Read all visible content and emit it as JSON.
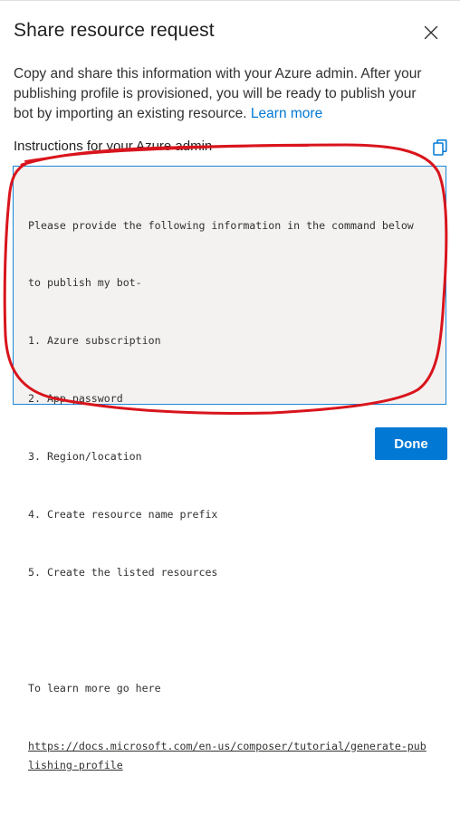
{
  "dialog": {
    "title": "Share resource request",
    "close_icon": "close-icon",
    "description": "Copy and share this information with your Azure admin. After your publishing profile is provisioned, you will be ready to publish your bot by importing an existing resource.",
    "learn_more_link": "Learn more",
    "section_label": "Instructions for your Azure admin",
    "copy_icon": "copy-icon",
    "instructions": {
      "intro_line1": "Please provide the following information in the command below",
      "intro_line2": "to publish my bot-",
      "items": [
        "1. Azure subscription",
        "2. App password",
        "3. Region/location",
        "4. Create resource name prefix",
        "5. Create the listed resources"
      ],
      "learn_more_text": "To learn more go here",
      "url": "https://docs.microsoft.com/en-us/composer/tutorial/generate-publishing-profile"
    },
    "done_label": "Done"
  },
  "colors": {
    "accent": "#0078d4",
    "textbox_border": "#1a86d8",
    "textbox_bg": "#f3f2f1",
    "annotation": "#d9141c"
  }
}
